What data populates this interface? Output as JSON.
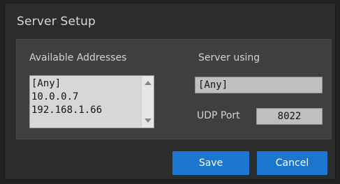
{
  "dialog": {
    "title": "Server Setup",
    "addresses": {
      "label": "Available Addresses",
      "items": [
        "[Any]",
        "10.0.0.7",
        "192.168.1.66"
      ]
    },
    "server_using": {
      "label": "Server using",
      "value": "[Any]"
    },
    "udp_port": {
      "label": "UDP Port",
      "value": "8022"
    },
    "buttons": {
      "save": "Save",
      "cancel": "Cancel"
    }
  },
  "colors": {
    "background": "#222222",
    "panel": "#3f3f3f",
    "button": "#1b76cf"
  },
  "icons": {
    "scroll_up": "chevron-up-icon",
    "scroll_down": "chevron-down-icon"
  }
}
